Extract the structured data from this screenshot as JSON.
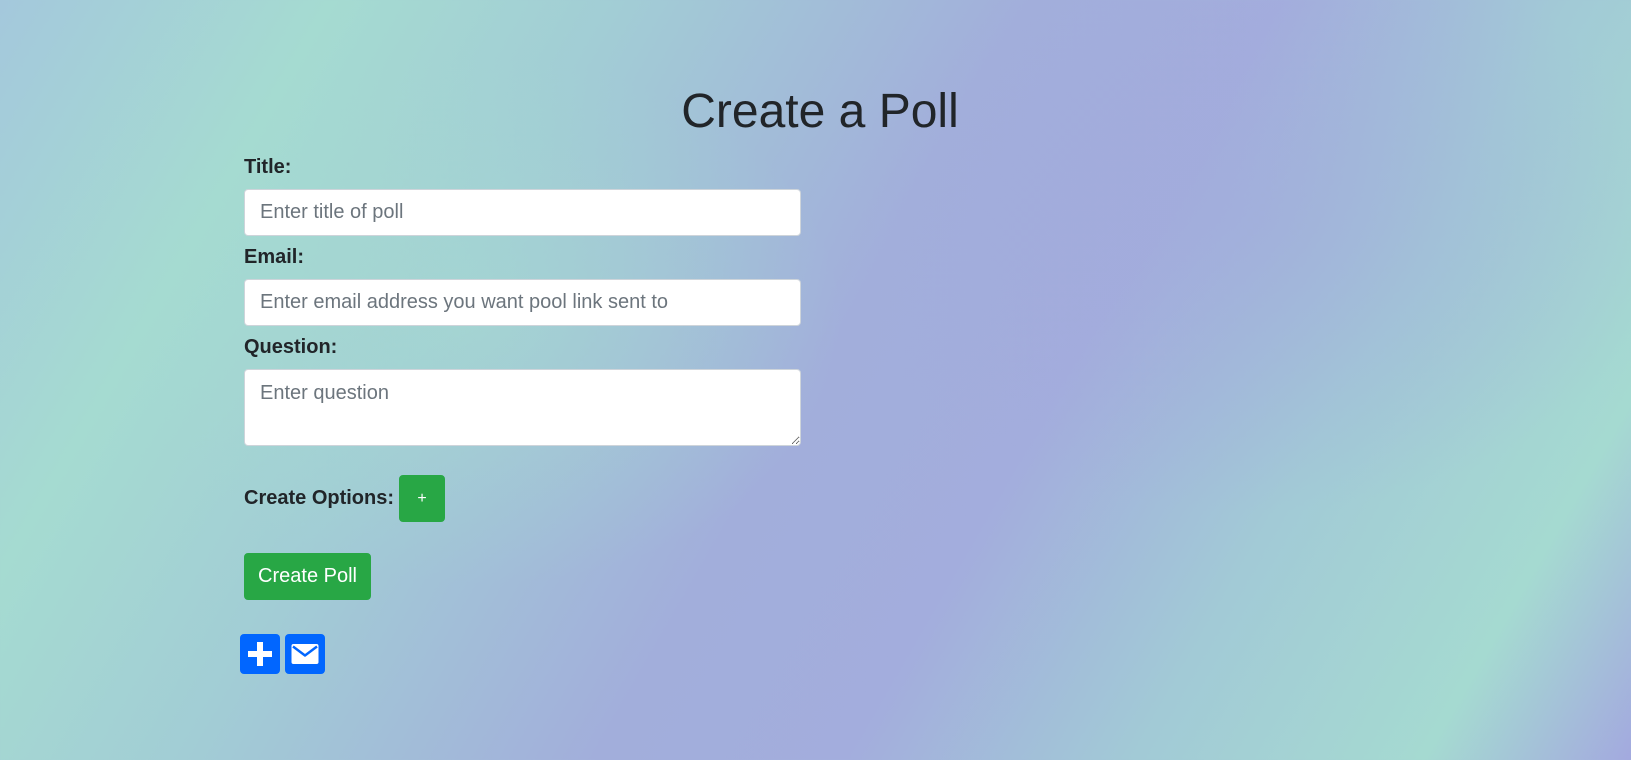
{
  "page": {
    "title": "Create a Poll"
  },
  "form": {
    "title_label": "Title:",
    "title_placeholder": "Enter title of poll",
    "email_label": "Email:",
    "email_placeholder": "Enter email address you want pool link sent to",
    "question_label": "Question:",
    "question_placeholder": "Enter question",
    "options_label": "Create Options:",
    "add_option_label": "+",
    "submit_label": "Create Poll"
  },
  "share": {
    "icons": [
      "share-plus-icon",
      "email-icon"
    ]
  },
  "colors": {
    "accent_green": "#28a745",
    "share_blue": "#0166ff",
    "text": "#212529"
  }
}
